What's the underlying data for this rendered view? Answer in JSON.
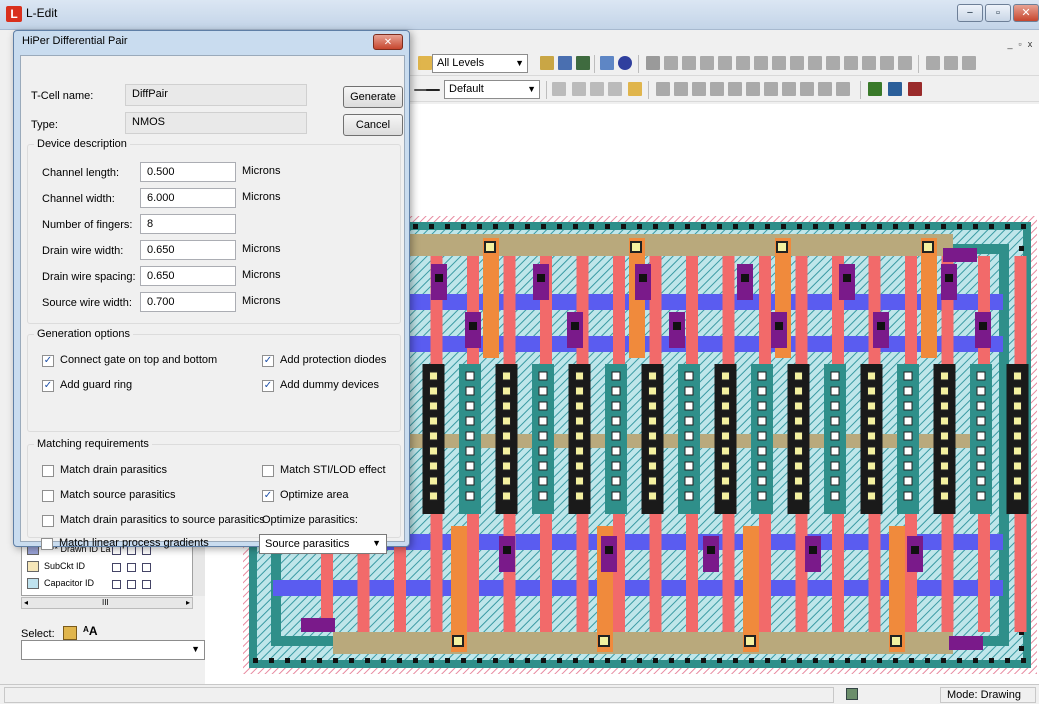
{
  "app": {
    "title": "L-Edit",
    "logo": "L"
  },
  "window_buttons": {
    "minimize": "−",
    "maximize": "▫",
    "close": "✕"
  },
  "toolbar": {
    "levels_select": "All Levels",
    "style_select": "Default"
  },
  "palette": {
    "rows": [
      {
        "label": "**** Drawn ID La",
        "color": "#9aa3d8"
      },
      {
        "label": "SubCkt ID",
        "color": "#f6e7b9"
      },
      {
        "label": "Capacitor ID",
        "color": "#bfe2ee"
      }
    ],
    "select_label": "Select:",
    "scroll_mark": "III"
  },
  "status": {
    "mode": "Mode: Drawing"
  },
  "dialog": {
    "title": "HiPer Differential Pair",
    "tcell_label": "T-Cell name:",
    "tcell_value": "DiffPair",
    "type_label": "Type:",
    "type_value": "NMOS",
    "generate_button": "Generate",
    "cancel_button": "Cancel",
    "device_group": "Device description",
    "params": [
      {
        "label": "Channel length:",
        "value": "0.500",
        "unit": "Microns"
      },
      {
        "label": "Channel width:",
        "value": "6.000",
        "unit": "Microns"
      },
      {
        "label": "Number of fingers:",
        "value": "8",
        "unit": ""
      },
      {
        "label": "Drain wire width:",
        "value": "0.650",
        "unit": "Microns"
      },
      {
        "label": "Drain wire spacing:",
        "value": "0.650",
        "unit": "Microns"
      },
      {
        "label": "Source wire width:",
        "value": "0.700",
        "unit": "Microns"
      }
    ],
    "generation_group": "Generation options",
    "gen_options": [
      {
        "label": "Connect gate on top and bottom",
        "checked": true
      },
      {
        "label": "Add protection diodes",
        "checked": true
      },
      {
        "label": "Add guard ring",
        "checked": true
      },
      {
        "label": "Add dummy devices",
        "checked": true
      }
    ],
    "matching_group": "Matching requirements",
    "match_options": [
      {
        "label": "Match drain parasitics",
        "checked": false
      },
      {
        "label": "Match STI/LOD effect",
        "checked": false
      },
      {
        "label": "Match source parasitics",
        "checked": false
      },
      {
        "label": "Optimize area",
        "checked": true
      },
      {
        "label": "Match drain parasitics to source parasitics",
        "checked": false
      },
      {
        "label": "Match linear process gradients",
        "checked": false
      }
    ],
    "optimize_label": "Optimize parasitics:",
    "optimize_value": "Source parasitics"
  },
  "icons": [
    "app-logo-icon",
    "minimize-icon",
    "maximize-icon",
    "close-icon",
    "dropdown-arrow-icon",
    "checkmark-icon",
    "drc-icon",
    "ext-icon",
    "select-cursor-icon",
    "text-tool-icon",
    "status-icon"
  ]
}
